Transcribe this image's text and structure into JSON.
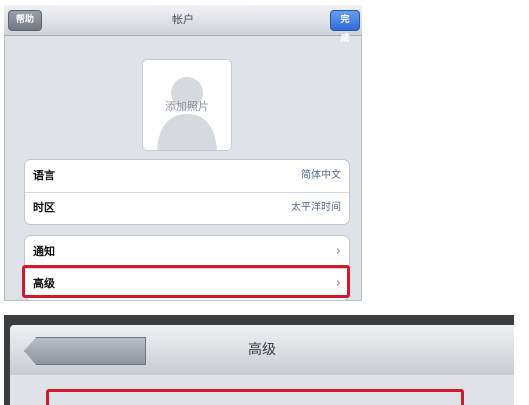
{
  "top_screen": {
    "navbar": {
      "help_label": "帮助",
      "title": "帐户",
      "done_label": "完成"
    },
    "photo": {
      "label": "添加照片"
    },
    "group1": [
      {
        "label": "语言",
        "value": "简体中文"
      },
      {
        "label": "时区",
        "value": "太平洋时间"
      }
    ],
    "group2": [
      {
        "label": "通知",
        "chevron": "›"
      },
      {
        "label": "高级",
        "chevron": "›"
      }
    ],
    "highlighted_row": "高级"
  },
  "bottom_screen": {
    "navbar": {
      "title": "高级"
    }
  },
  "colors": {
    "highlight": "#d3182a",
    "done_button": "#2f6ad9",
    "value_text": "#4e6a95"
  },
  "icons": {
    "photo_placeholder": "person-silhouette-icon",
    "row_arrow": "chevron-right-icon"
  }
}
